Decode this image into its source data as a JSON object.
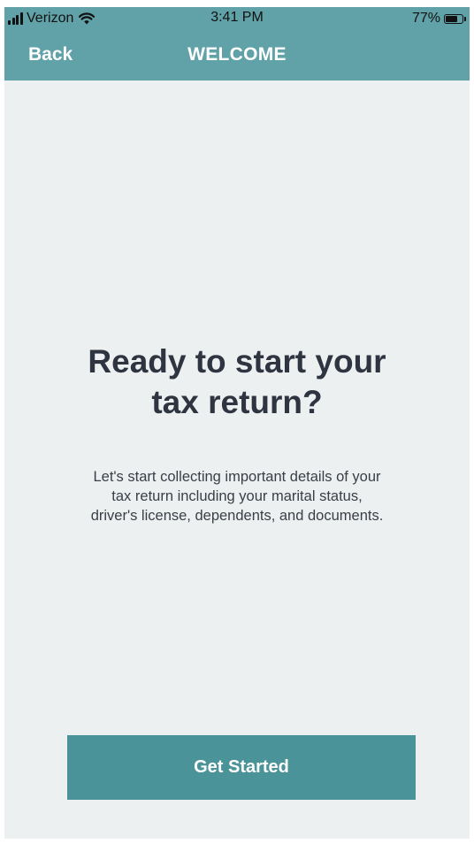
{
  "status_bar": {
    "carrier": "Verizon",
    "time": "3:41 PM",
    "battery_percent": "77%",
    "battery_level": 0.77,
    "signal_icon": "cellular-signal-icon",
    "wifi_icon": "wifi-icon",
    "battery_icon": "battery-icon"
  },
  "nav": {
    "back_label": "Back",
    "title": "WELCOME"
  },
  "main": {
    "headline_line1": "Ready to start your",
    "headline_line2": "tax return?",
    "description_line1": "Let's start collecting important details of your",
    "description_line2": "tax return including your marital status,",
    "description_line3": "driver's license, dependents, and documents.",
    "cta_label": "Get Started"
  },
  "colors": {
    "header_bg": "#60a2a7",
    "page_bg": "#edf0f1",
    "button_bg": "#4a9398",
    "heading_text": "#2e3440"
  }
}
